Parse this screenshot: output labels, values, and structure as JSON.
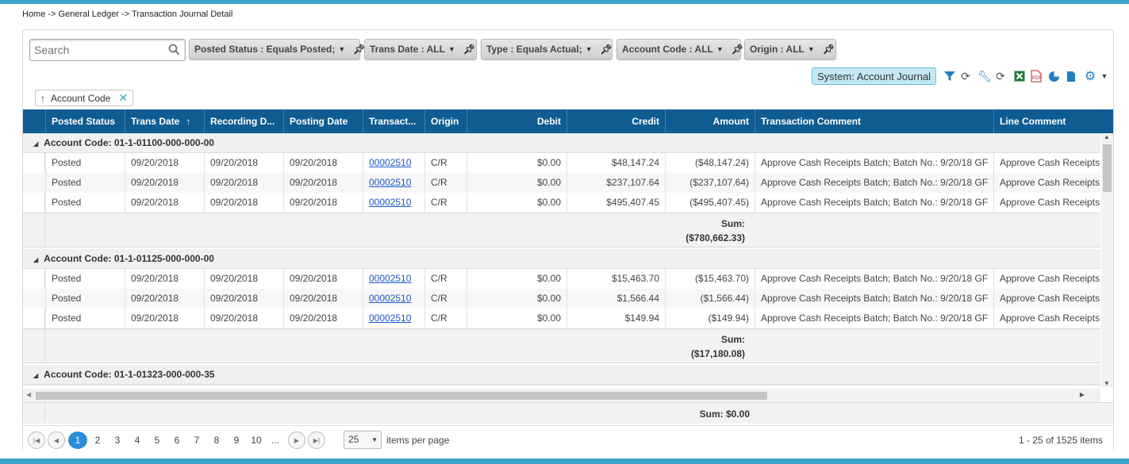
{
  "breadcrumb": "Home -> General Ledger -> Transaction Journal Detail",
  "search": {
    "placeholder": "Search"
  },
  "filters": [
    {
      "label": "Posted Status : Equals Posted;"
    },
    {
      "label": "Trans Date : ALL"
    },
    {
      "label": "Type : Equals Actual;"
    },
    {
      "label": "Account Code : ALL"
    },
    {
      "label": "Origin : ALL"
    }
  ],
  "toolbar": {
    "view_label": "System: Account Journal"
  },
  "group_chip": {
    "label": "Account Code"
  },
  "columns": [
    "Posted Status",
    "Trans Date",
    "Recording D...",
    "Posting Date",
    "Transact...",
    "Origin",
    "Debit",
    "Credit",
    "Amount",
    "Transaction Comment",
    "Line Comment"
  ],
  "groups": [
    {
      "label": "Account Code: 01-1-01100-000-000-00",
      "rows": [
        {
          "status": "Posted",
          "trans": "09/20/2018",
          "rec": "09/20/2018",
          "post": "09/20/2018",
          "txn": "00002510",
          "origin": "C/R",
          "debit": "$0.00",
          "credit": "$48,147.24",
          "amount": "($48,147.24)",
          "tcomment": "Approve Cash Receipts Batch; Batch No.: 9/20/18 GF",
          "lcomment": "Approve Cash Receipts Batch"
        },
        {
          "status": "Posted",
          "trans": "09/20/2018",
          "rec": "09/20/2018",
          "post": "09/20/2018",
          "txn": "00002510",
          "origin": "C/R",
          "debit": "$0.00",
          "credit": "$237,107.64",
          "amount": "($237,107.64)",
          "tcomment": "Approve Cash Receipts Batch; Batch No.: 9/20/18 GF",
          "lcomment": "Approve Cash Receipts Batch"
        },
        {
          "status": "Posted",
          "trans": "09/20/2018",
          "rec": "09/20/2018",
          "post": "09/20/2018",
          "txn": "00002510",
          "origin": "C/R",
          "debit": "$0.00",
          "credit": "$495,407.45",
          "amount": "($495,407.45)",
          "tcomment": "Approve Cash Receipts Batch; Batch No.: 9/20/18 GF",
          "lcomment": "Approve Cash Receipts Batch"
        }
      ],
      "sum_label": "Sum:",
      "sum_value": "($780,662.33)"
    },
    {
      "label": "Account Code: 01-1-01125-000-000-00",
      "rows": [
        {
          "status": "Posted",
          "trans": "09/20/2018",
          "rec": "09/20/2018",
          "post": "09/20/2018",
          "txn": "00002510",
          "origin": "C/R",
          "debit": "$0.00",
          "credit": "$15,463.70",
          "amount": "($15,463.70)",
          "tcomment": "Approve Cash Receipts Batch; Batch No.: 9/20/18 GF",
          "lcomment": "Approve Cash Receipts Batch"
        },
        {
          "status": "Posted",
          "trans": "09/20/2018",
          "rec": "09/20/2018",
          "post": "09/20/2018",
          "txn": "00002510",
          "origin": "C/R",
          "debit": "$0.00",
          "credit": "$1,566.44",
          "amount": "($1,566.44)",
          "tcomment": "Approve Cash Receipts Batch; Batch No.: 9/20/18 GF",
          "lcomment": "Approve Cash Receipts Batch"
        },
        {
          "status": "Posted",
          "trans": "09/20/2018",
          "rec": "09/20/2018",
          "post": "09/20/2018",
          "txn": "00002510",
          "origin": "C/R",
          "debit": "$0.00",
          "credit": "$149.94",
          "amount": "($149.94)",
          "tcomment": "Approve Cash Receipts Batch; Batch No.: 9/20/18 GF",
          "lcomment": "Approve Cash Receipts Batch"
        }
      ],
      "sum_label": "Sum:",
      "sum_value": "($17,180.08)"
    },
    {
      "label": "Account Code: 01-1-01323-000-000-35",
      "rows": []
    }
  ],
  "grand_total": "Sum: $0.00",
  "pager": {
    "pages": [
      "1",
      "2",
      "3",
      "4",
      "5",
      "6",
      "7",
      "8",
      "9",
      "10",
      "..."
    ],
    "current": "1",
    "page_size": "25",
    "page_size_label": "items per page",
    "summary": "1 - 25 of 1525 items"
  },
  "colors": {
    "accent": "#3aa6c9",
    "header_bg": "#0f5c93",
    "link": "#1a57c9",
    "pager_active": "#2b8dd6"
  }
}
